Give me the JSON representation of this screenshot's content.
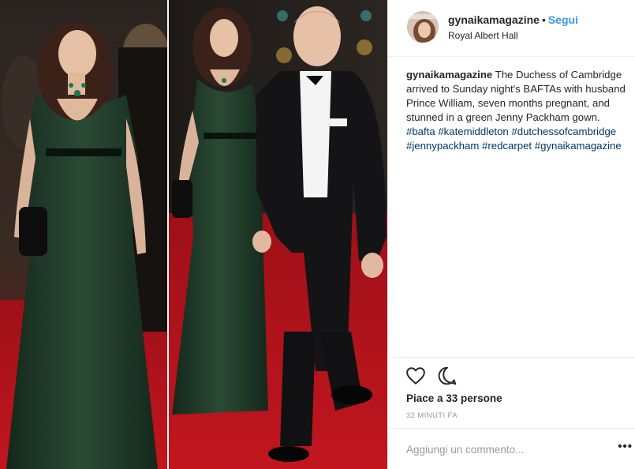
{
  "post": {
    "username": "gynaikamagazine",
    "separator": "•",
    "follow_label": "Segui",
    "location": "Royal Albert Hall",
    "caption_user": "gynaikamagazine",
    "caption_text": "The Duchess of Cambridge arrived to Sunday night's BAFTAs with husband Prince William, seven months pregnant, and stunned in a green Jenny Packham gown.",
    "hashtags": "#bafta #katemiddleton #dutchessofcambridge #jennypackham #redcarpet #gynaikamagazine",
    "likes": "Piace a 33 persone",
    "time": "32 MINUTI FA",
    "comment_placeholder": "Aggiungi un commento...",
    "more_label": "•••"
  },
  "icons": {
    "like": "heart-icon",
    "comment": "comment-bubble-icon",
    "more": "ellipsis-icon"
  },
  "colors": {
    "link": "#3897f0",
    "hashtag": "#003569",
    "carpet": "#b3141c",
    "gown": "#1f3b2a"
  }
}
